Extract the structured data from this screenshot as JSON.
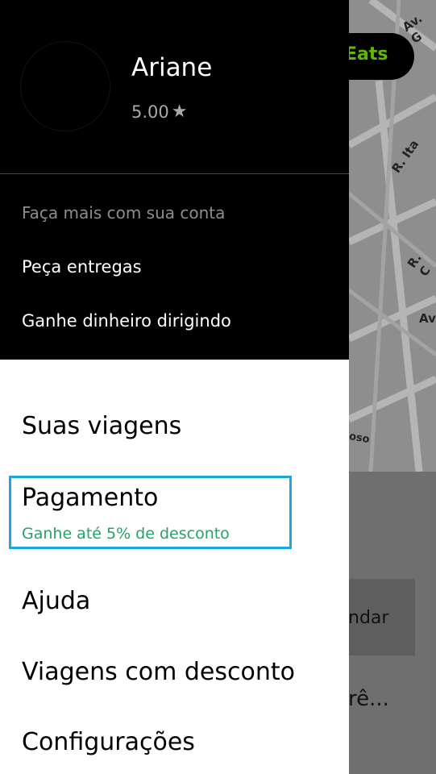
{
  "map": {
    "eats_label": "Eats",
    "street_labels": [
      "Av. G",
      "R. Ita",
      "R. C",
      "Av",
      "oso"
    ],
    "schedule_label": "ndar",
    "destination_label": "rê..."
  },
  "drawer": {
    "user": {
      "name": "Ariane",
      "rating": "5.00",
      "rating_icon": "star-icon"
    },
    "account_section": {
      "label": "Faça mais com sua conta",
      "links": [
        "Peça entregas",
        "Ganhe dinheiro dirigindo"
      ]
    },
    "menu": {
      "items": [
        "Suas viagens",
        "Pagamento",
        "Ajuda",
        "Viagens com desconto",
        "Configurações"
      ],
      "payment_promo": "Ganhe até 5% de desconto"
    },
    "colors": {
      "header_bg": "#000000",
      "highlight_border": "#1ea7de",
      "promo_text": "#27a06a",
      "eats_green": "#5fb709"
    }
  }
}
